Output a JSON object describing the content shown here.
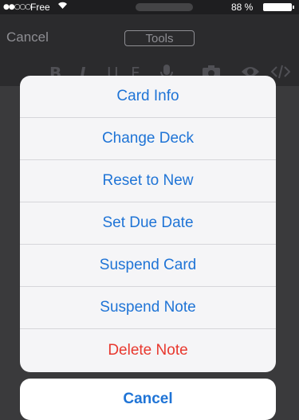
{
  "status_bar": {
    "signal": "●●○○○",
    "carrier": "Free",
    "battery_percent": "88 %",
    "battery_level": 0.88
  },
  "nav_bar": {
    "cancel_label": "Cancel",
    "tools_label": "Tools"
  },
  "toolbar": {
    "icons": [
      "bold-icon",
      "italic-icon",
      "underline-icon",
      "formula-icon",
      "microphone-icon",
      "camera-icon",
      "eye-icon",
      "code-icon"
    ],
    "bold": "B",
    "italic": "I",
    "underline": "U",
    "formula": "F"
  },
  "action_sheet": {
    "items": [
      {
        "label": "Card Info"
      },
      {
        "label": "Change Deck"
      },
      {
        "label": "Reset to New"
      },
      {
        "label": "Set Due Date"
      },
      {
        "label": "Suspend Card"
      },
      {
        "label": "Suspend Note"
      },
      {
        "label": "Delete Note",
        "destructive": true
      }
    ],
    "cancel_label": "Cancel"
  },
  "colors": {
    "action": "#1f74d6",
    "destructive": "#e8382e"
  }
}
